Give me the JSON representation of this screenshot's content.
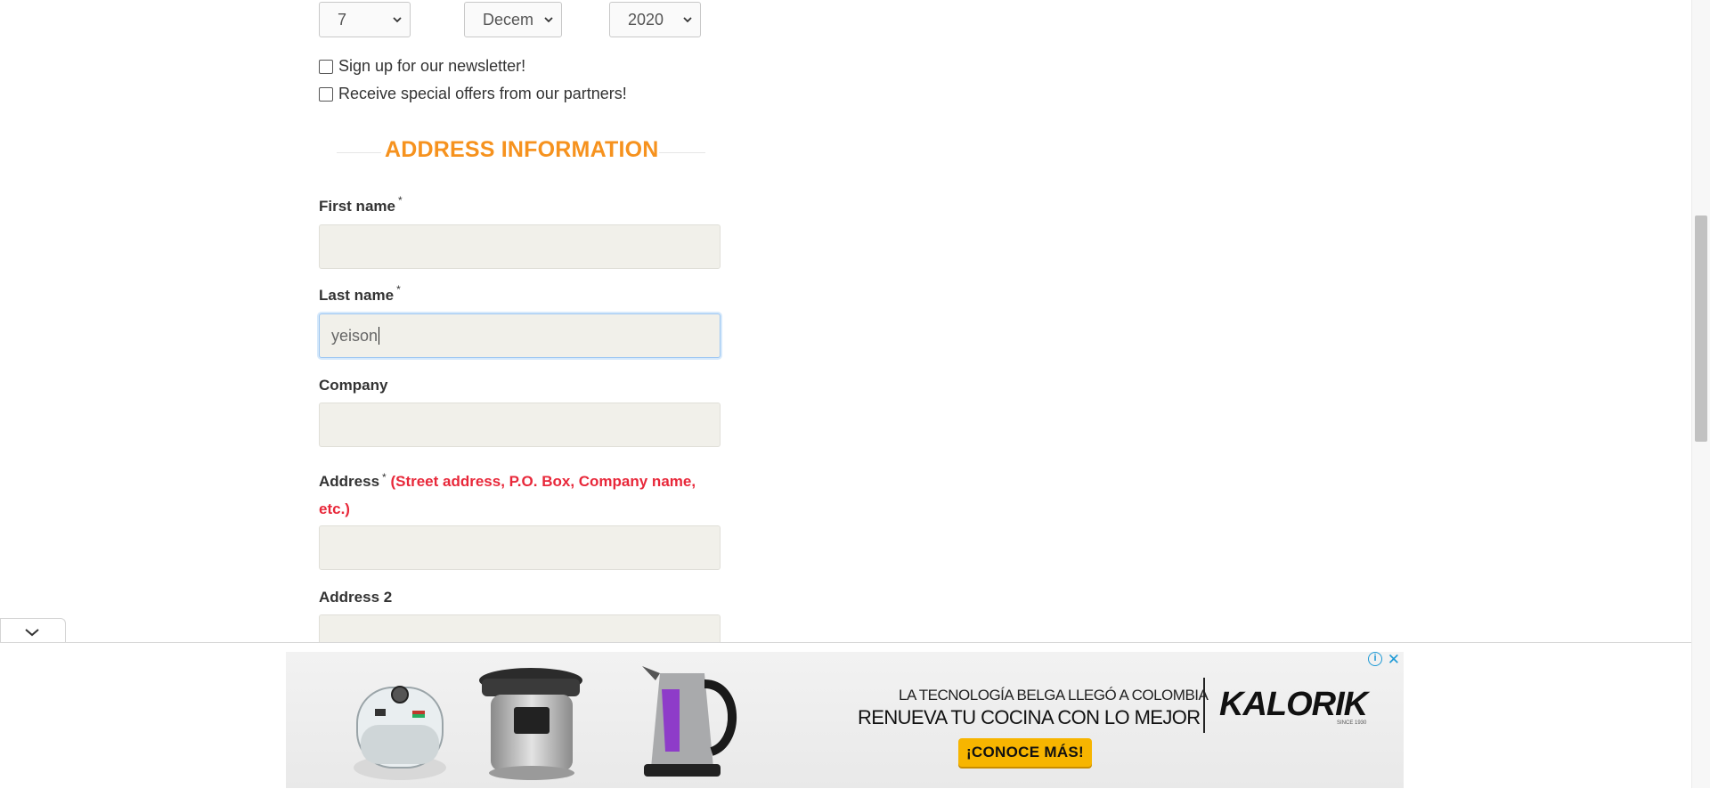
{
  "dob": {
    "day": "7",
    "month": "Decem",
    "year": "2020"
  },
  "checkboxes": {
    "newsletter": "Sign up for our newsletter!",
    "offers": "Receive special offers from our partners!"
  },
  "address_section": {
    "title": "ADDRESS INFORMATION",
    "required_mark": "*",
    "first_name_label": "First name",
    "first_name_value": "",
    "last_name_label": "Last name",
    "last_name_value": "yeison",
    "company_label": "Company",
    "company_value": "",
    "address_label": "Address",
    "address_hint": "(Street address, P.O. Box, Company name, etc.)",
    "address_value": "",
    "address2_label": "Address 2",
    "address2_value": ""
  },
  "ad": {
    "tagline": "LA TECNOLOGÍA BELGA LLEGÓ A COLOMBIA",
    "headline": "RENUEVA TU COCINA CON LO MEJOR",
    "brand": "KALORIK",
    "brand_sub": "SINCE 1930",
    "cta": "¡CONOCE MÁS!",
    "info_icon": "i",
    "close_icon": "✕"
  },
  "colors": {
    "heading": "#f6921e",
    "hint": "#e8283a",
    "input_bg": "#f1f0ea",
    "cta": "#f7b500",
    "ad_controls": "#1e9ad6"
  }
}
